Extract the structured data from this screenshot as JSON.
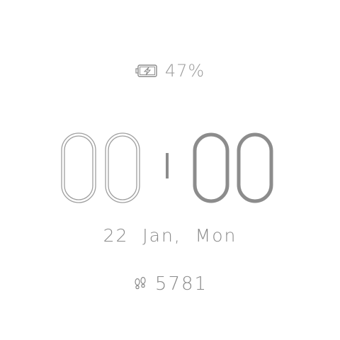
{
  "status": {
    "battery_percent": "47%",
    "battery_icon": "battery-charging-icon"
  },
  "clock": {
    "hours": "00",
    "minutes": "00",
    "hours_color": "#9e9e9e",
    "minutes_color": "#8c8c8c",
    "separator_color": "#8c8c8c"
  },
  "date": {
    "text": "22  Jan,  Mon"
  },
  "activity": {
    "steps": "5781",
    "steps_icon": "footsteps-icon"
  }
}
